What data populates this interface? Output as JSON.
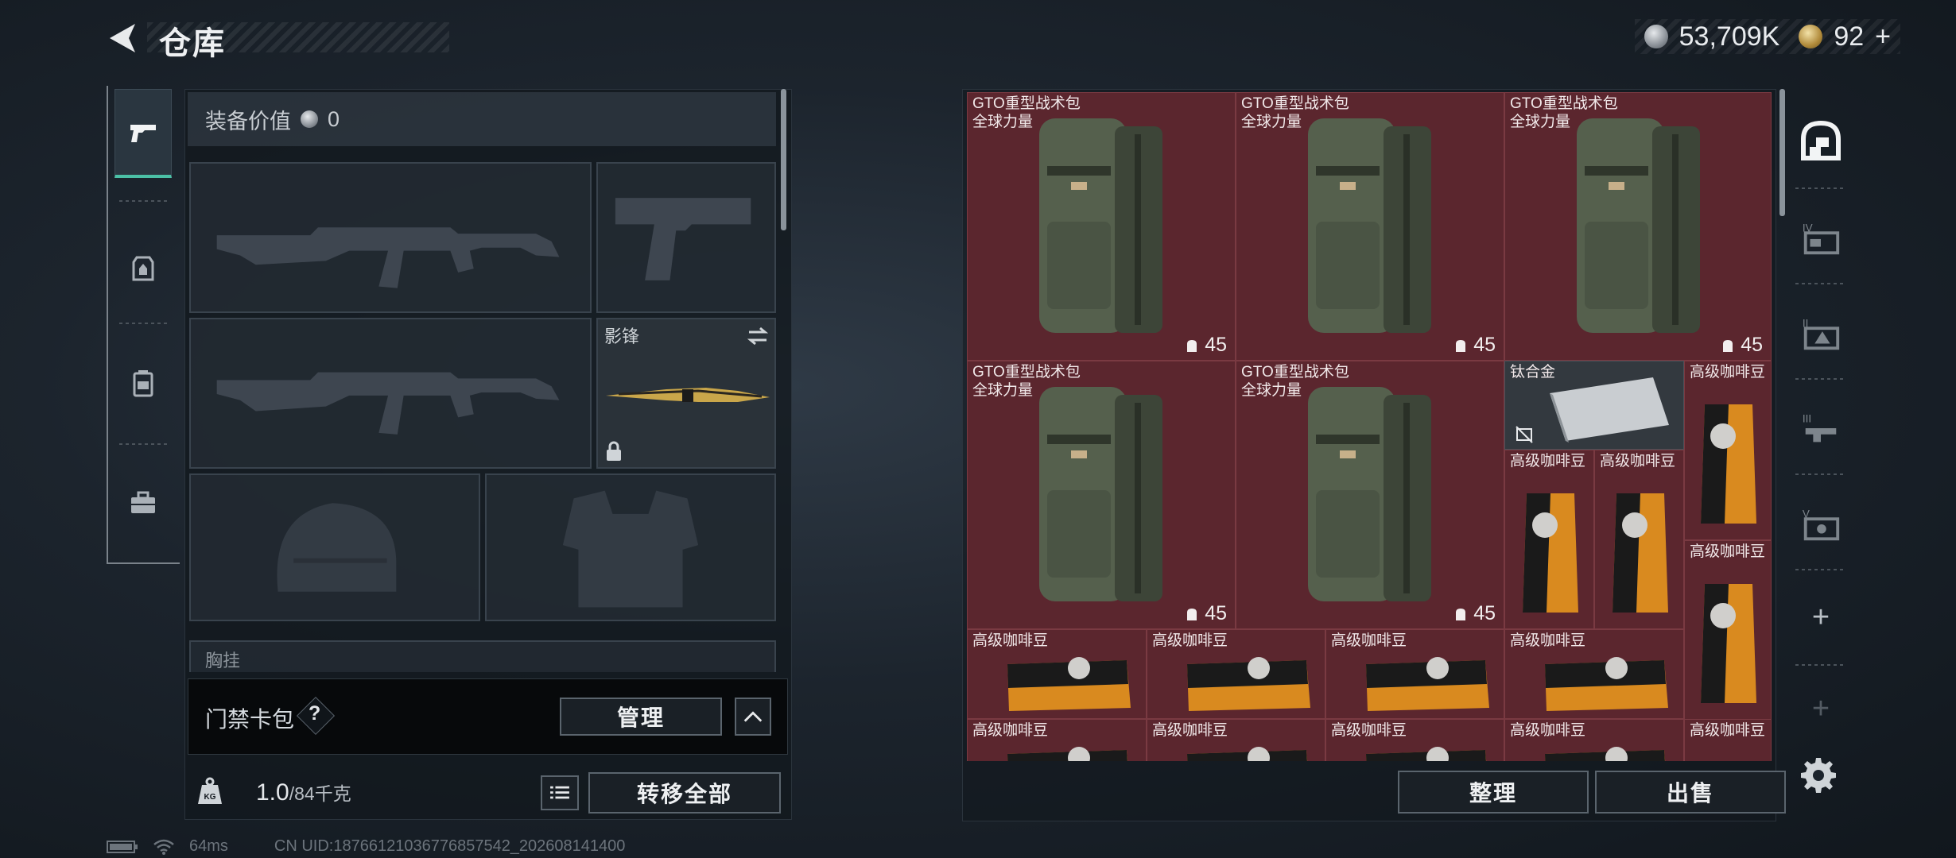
{
  "header": {
    "title": "仓库",
    "currency_silver": "53,709K",
    "currency_gold": "92",
    "currency_gold_plus": "+"
  },
  "left": {
    "equip_value_label": "装备价值",
    "equip_value": "0",
    "melee_name": "影锋",
    "chest_rig_label": "胸挂",
    "chest_rig_hint": "?",
    "keycard_label": "门禁卡包",
    "keycard_hint": "?",
    "manage_button": "管理",
    "weight_current": "1.0",
    "weight_max": "/84千克",
    "transfer_all_button": "转移全部"
  },
  "status": {
    "ping": "64ms",
    "uid": "CN UID:18766121036776857542_202608141400"
  },
  "stash": {
    "items": [
      {
        "name1": "GTO重型战术包",
        "name2": "全球力量",
        "count": "45"
      },
      {
        "name1": "GTO重型战术包",
        "name2": "全球力量",
        "count": "45"
      },
      {
        "name1": "GTO重型战术包",
        "name2": "全球力量",
        "count": "45"
      },
      {
        "name1": "GTO重型战术包",
        "name2": "全球力量",
        "count": "45"
      },
      {
        "name1": "GTO重型战术包",
        "name2": "全球力量",
        "count": "45"
      }
    ],
    "titanium_name": "钛合金",
    "coffee_name": "高级咖啡豆",
    "sort_button": "整理",
    "sell_button": "出售"
  },
  "colors": {
    "accent": "#4bc0a6",
    "stash_bg": "#5b262e",
    "panel_bg": "#12181e"
  }
}
